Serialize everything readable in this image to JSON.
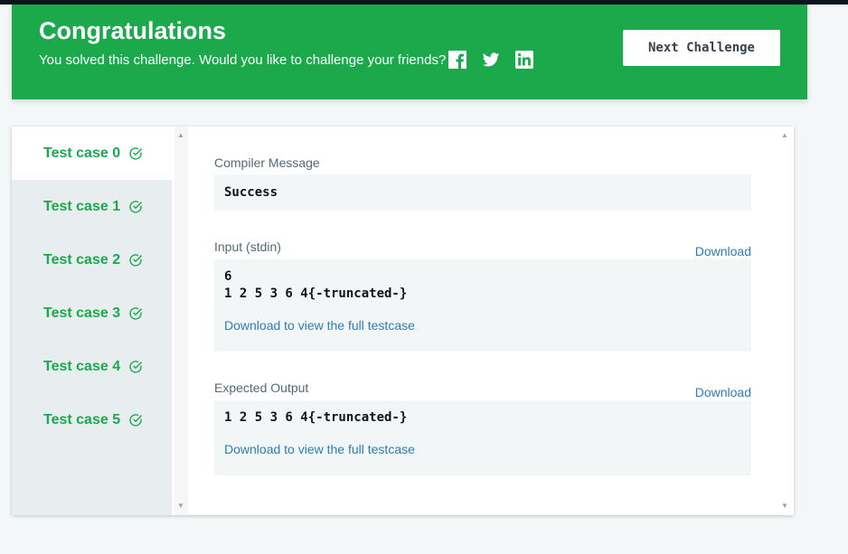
{
  "banner": {
    "title": "Congratulations",
    "subtitle": "You solved this challenge. Would you like to challenge your friends?",
    "social": [
      "facebook-icon",
      "twitter-icon",
      "linkedin-icon"
    ],
    "next_button": "Next Challenge",
    "color": "#1ba94c"
  },
  "tabs": [
    {
      "label": "Test case 0",
      "status": "passed"
    },
    {
      "label": "Test case 1",
      "status": "passed"
    },
    {
      "label": "Test case 2",
      "status": "passed"
    },
    {
      "label": "Test case 3",
      "status": "passed"
    },
    {
      "label": "Test case 4",
      "status": "passed"
    },
    {
      "label": "Test case 5",
      "status": "passed"
    }
  ],
  "active_tab": 0,
  "result": {
    "compiler_label": "Compiler Message",
    "compiler_message": "Success",
    "input_label": "Input (stdin)",
    "input_download": "Download",
    "input_lines": [
      "6",
      "1 2 5 3 6 4{-truncated-}"
    ],
    "input_full_link": "Download to view the full testcase",
    "expected_label": "Expected Output",
    "expected_download": "Download",
    "expected_lines": [
      "1 2 5 3 6 4{-truncated-}"
    ],
    "expected_full_link": "Download to view the full testcase"
  }
}
